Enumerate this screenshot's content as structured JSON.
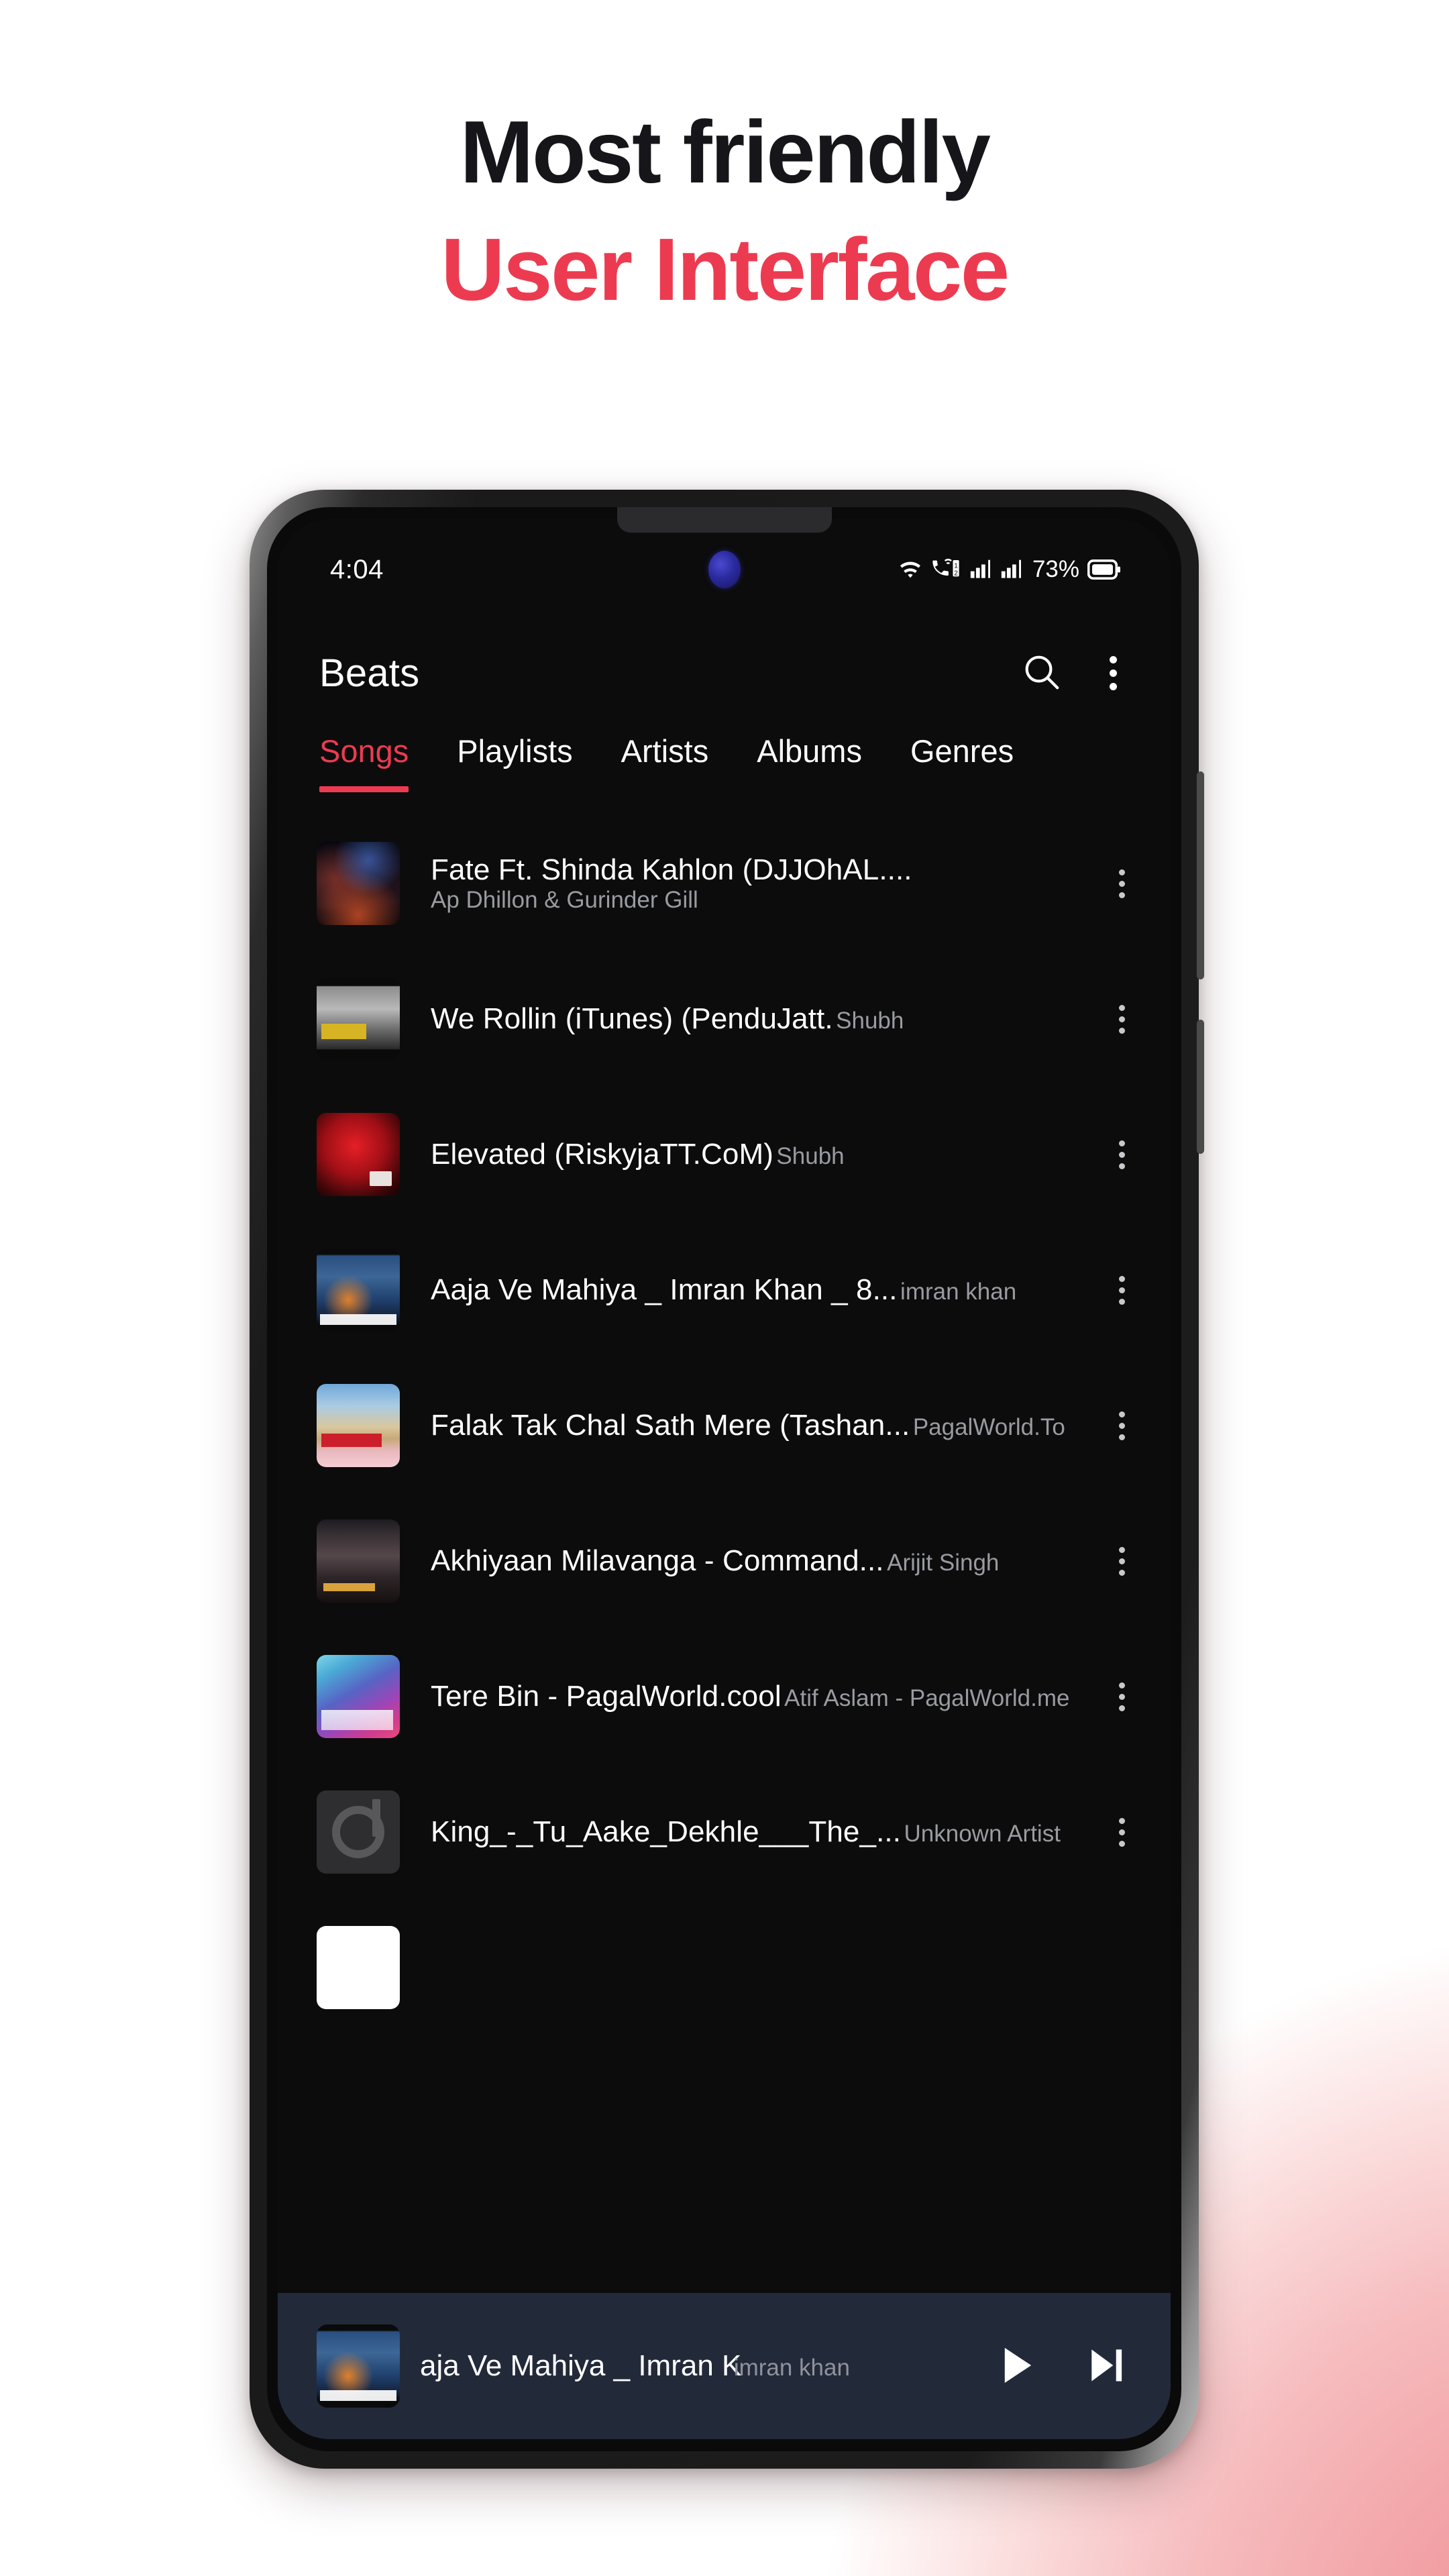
{
  "headline": {
    "line1": "Most friendly",
    "line2": "User Interface",
    "accent_color": "#ec3b50",
    "dark_color": "#16161a"
  },
  "phone": {
    "statusbar": {
      "time": "4:04",
      "battery_percent": "73%",
      "icons": [
        "wifi-icon",
        "call-signal-icon",
        "sim1-signal-icon",
        "sim2-signal-icon",
        "battery-icon"
      ]
    },
    "appbar": {
      "title": "Beats",
      "search_label": "Search",
      "overflow_label": "More options"
    },
    "tabs": [
      {
        "label": "Songs",
        "active": true
      },
      {
        "label": "Playlists",
        "active": false
      },
      {
        "label": "Artists",
        "active": false
      },
      {
        "label": "Albums",
        "active": false
      },
      {
        "label": "Genres",
        "active": false
      }
    ],
    "songs": [
      {
        "title": "Fate Ft. Shinda Kahlon (DJJOhAL....",
        "artist": "Ap Dhillon & Gurinder Gill"
      },
      {
        "title": "We Rollin (iTunes) (PenduJatt.",
        "artist": "Shubh"
      },
      {
        "title": "Elevated (RiskyjaTT.CoM)",
        "artist": "Shubh"
      },
      {
        "title": "Aaja Ve Mahiya _ Imran Khan _ 8...",
        "artist": "imran khan"
      },
      {
        "title": "Falak Tak Chal Sath Mere (Tashan...",
        "artist": "PagalWorld.To"
      },
      {
        "title": "Akhiyaan Milavanga - Command...",
        "artist": "Arijit Singh"
      },
      {
        "title": "Tere Bin - PagalWorld.cool",
        "artist": "Atif Aslam - PagalWorld.me"
      },
      {
        "title": "King_-_Tu_Aake_Dekhle___The_...",
        "artist": "Unknown Artist"
      }
    ],
    "miniplayer": {
      "title": "aja Ve Mahiya _ Imran K",
      "artist": "imran khan",
      "play_label": "Play",
      "next_label": "Next",
      "background_color": "#222a3a"
    }
  }
}
